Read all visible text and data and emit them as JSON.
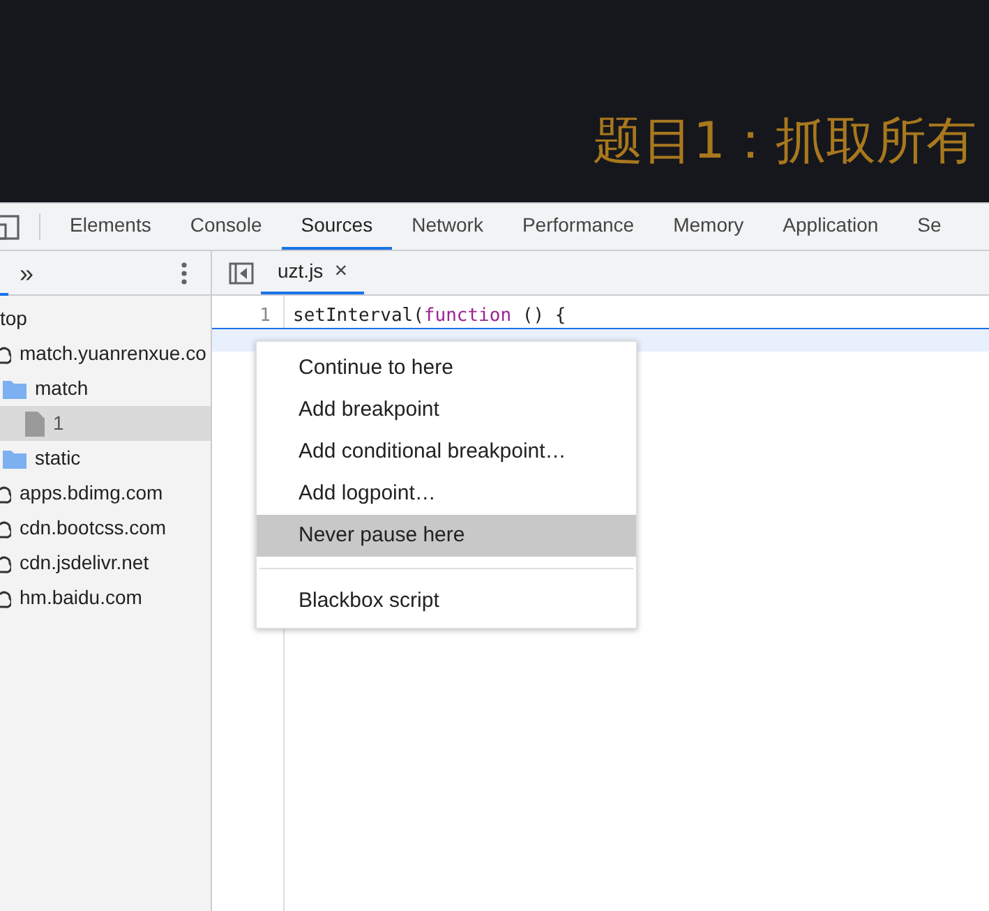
{
  "page_heading": "题目1：抓取所有",
  "devtools": {
    "tabs": [
      {
        "label": "Elements",
        "selected": false
      },
      {
        "label": "Console",
        "selected": false
      },
      {
        "label": "Sources",
        "selected": true
      },
      {
        "label": "Network",
        "selected": false
      },
      {
        "label": "Performance",
        "selected": false
      },
      {
        "label": "Memory",
        "selected": false
      },
      {
        "label": "Application",
        "selected": false
      },
      {
        "label": "Se",
        "selected": false
      }
    ],
    "navigator": {
      "more_tabs": "»",
      "tree": [
        {
          "label": "top",
          "kind": "frame",
          "selected": false,
          "children": [
            {
              "label": "match.yuanrenxue.co",
              "kind": "domain",
              "selected": false,
              "children": [
                {
                  "label": "match",
                  "kind": "folder",
                  "selected": false,
                  "children": [
                    {
                      "label": "1",
                      "kind": "file",
                      "selected": true
                    }
                  ]
                },
                {
                  "label": "static",
                  "kind": "folder",
                  "selected": false
                }
              ]
            },
            {
              "label": "apps.bdimg.com",
              "kind": "domain",
              "selected": false
            },
            {
              "label": "cdn.bootcss.com",
              "kind": "domain",
              "selected": false
            },
            {
              "label": "cdn.jsdelivr.net",
              "kind": "domain",
              "selected": false
            },
            {
              "label": "hm.baidu.com",
              "kind": "domain",
              "selected": false
            }
          ]
        }
      ]
    },
    "editor": {
      "file_tab": {
        "label": "uzt.js",
        "close": "×",
        "selected": true
      },
      "lines": [
        {
          "number": "1",
          "selected": false,
          "tokens": [
            {
              "text": "setInterval(",
              "kind": "plain"
            },
            {
              "text": "function",
              "kind": "keyword"
            },
            {
              "text": " () {",
              "kind": "plain"
            }
          ]
        },
        {
          "selected": true
        }
      ]
    },
    "context_menu": {
      "items": [
        {
          "label": "Continue to here",
          "kind": "item",
          "selected": false
        },
        {
          "label": "Add breakpoint",
          "kind": "item",
          "selected": false
        },
        {
          "label": "Add conditional breakpoint…",
          "kind": "item",
          "selected": false
        },
        {
          "label": "Add logpoint…",
          "kind": "item",
          "selected": false
        },
        {
          "label": "Never pause here",
          "kind": "item",
          "selected": true
        },
        {
          "kind": "separator"
        },
        {
          "label": "Blackbox script",
          "kind": "item",
          "selected": false
        }
      ]
    }
  }
}
